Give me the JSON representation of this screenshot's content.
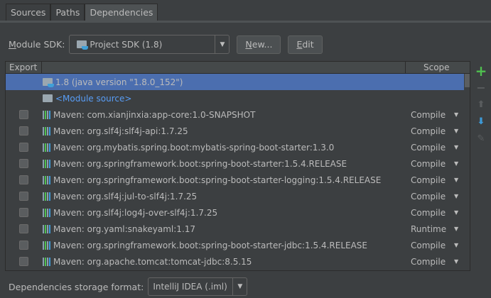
{
  "tabs": [
    "Sources",
    "Paths",
    "Dependencies"
  ],
  "sdk": {
    "label_u": "M",
    "label_rest": "odule SDK:",
    "value": "Project SDK (1.8)",
    "new_u": "N",
    "new_rest": "ew...",
    "edit_u": "E",
    "edit_rest": "dit"
  },
  "table": {
    "headers": {
      "export": "Export",
      "scope": "Scope"
    },
    "sdk_row": "1.8 (java version \"1.8.0_152\")",
    "module_source": "<Module source>",
    "rows": [
      {
        "name": "Maven: com.xianjinxia:app-core:1.0-SNAPSHOT",
        "scope": "Compile"
      },
      {
        "name": "Maven: org.slf4j:slf4j-api:1.7.25",
        "scope": "Compile"
      },
      {
        "name": "Maven: org.mybatis.spring.boot:mybatis-spring-boot-starter:1.3.0",
        "scope": "Compile"
      },
      {
        "name": "Maven: org.springframework.boot:spring-boot-starter:1.5.4.RELEASE",
        "scope": "Compile"
      },
      {
        "name": "Maven: org.springframework.boot:spring-boot-starter-logging:1.5.4.RELEASE",
        "scope": "Compile"
      },
      {
        "name": "Maven: org.slf4j:jul-to-slf4j:1.7.25",
        "scope": "Compile"
      },
      {
        "name": "Maven: org.slf4j:log4j-over-slf4j:1.7.25",
        "scope": "Compile"
      },
      {
        "name": "Maven: org.yaml:snakeyaml:1.17",
        "scope": "Runtime"
      },
      {
        "name": "Maven: org.springframework.boot:spring-boot-starter-jdbc:1.5.4.RELEASE",
        "scope": "Compile"
      },
      {
        "name": "Maven: org.apache.tomcat:tomcat-jdbc:8.5.15",
        "scope": "Compile"
      }
    ]
  },
  "bottom": {
    "label": "Dependencies storage format:",
    "value": "IntelliJ IDEA (.iml)"
  },
  "colors": {
    "selection": "#4b6eaf",
    "add": "#4fc04f",
    "down": "#3d9ad8",
    "link": "#589df6"
  }
}
